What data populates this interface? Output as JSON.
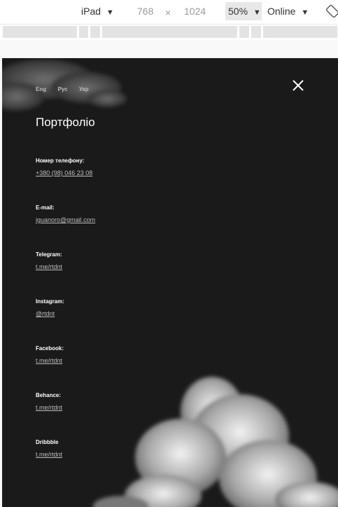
{
  "toolbar": {
    "device": "iPad",
    "width": "768",
    "times": "×",
    "height": "1024",
    "zoom": "50%",
    "network": "Online",
    "caret": "▼"
  },
  "nav": {
    "languages": [
      "Eng",
      "Рус",
      "Укр"
    ],
    "close_icon": "close-icon"
  },
  "page_title": "Портфоліо",
  "contacts": [
    {
      "label": "Номер телефону:",
      "value": "+380 (98) 046 23 08"
    },
    {
      "label": "E-mail:",
      "value": "iguanoro@gmail.com"
    },
    {
      "label": "Telegram:",
      "value": "t.me/rtdnt"
    },
    {
      "label": "Instagram:",
      "value": "@rtdnt"
    },
    {
      "label": "Facebook:",
      "value": "t.me/rtdnt"
    },
    {
      "label": "Behance:",
      "value": "t.me/rtdnt"
    },
    {
      "label": "Dribbble",
      "value": "t.me/rtdnt"
    }
  ],
  "colors": {
    "background": "#1a1a1a",
    "text": "#ffffff",
    "muted": "#bdbdbd"
  }
}
